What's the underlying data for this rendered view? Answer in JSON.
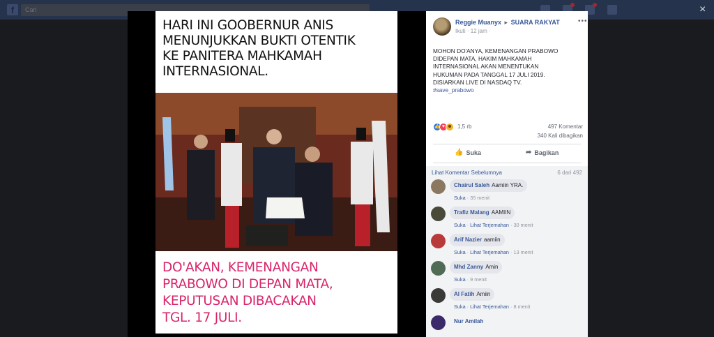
{
  "topbar": {
    "logo": "f",
    "search_placeholder": "Cari",
    "close_label": "×"
  },
  "meme": {
    "top_lines": [
      "HARI INI GOOBERNUR ANIS",
      "MENUNJUKKAN BUKTI OTENTIK",
      "KE PANITERA MAHKAMAH",
      "INTERNASIONAL."
    ],
    "bottom_lines": [
      "DO'AKAN, KEMENANGAN",
      "PRABOWO DI DEPAN MATA,",
      "KEPUTUSAN DIBACAKAN",
      "TGL. 17 JULI."
    ]
  },
  "post": {
    "author": "Reggie Muanyx",
    "arrow": "▸",
    "group": "SUARA RAKYAT",
    "meta": "Ikuti · 12 jam ·",
    "more": "•••",
    "text_lines": [
      "MOHON DO'ANYA, KEMENANGAN PRABOWO",
      "DIDEPAN MATA, HAKIM MAHKAMAH",
      "INTERNASIONAL AKAN MENENTUKAN",
      "HUKUMAN PADA TANGGAL 17 JULI 2019.",
      "DISIARKAN LIVE DI NASDAQ TV."
    ],
    "hashtag": "#save_prabowo",
    "reaction_count": "1,5 rb",
    "comments_count": "497 Komentar",
    "shares_count": "340 Kali dibagikan",
    "like_label": "Suka",
    "share_label": "Bagikan"
  },
  "comments_header": {
    "prev_link": "Lihat Komentar Sebelumnya",
    "page_count": "6 dari 492"
  },
  "comments": [
    {
      "name": "Chairul Saleh",
      "text": "Aamiin YRA.",
      "like": "Suka",
      "translate": "",
      "time": "35 menit",
      "avatar_color": "#8a7860"
    },
    {
      "name": "Trafiz Malang",
      "text": "AAMIIN",
      "like": "Suka",
      "translate": "Lihat Terjemahan",
      "time": "30 menit",
      "avatar_color": "#4a4a3a"
    },
    {
      "name": "Arif Nazier",
      "text": "aamiin",
      "like": "Suka",
      "translate": "Lihat Terjemahan",
      "time": "13 menit",
      "avatar_color": "#b83a3a"
    },
    {
      "name": "Mhd Zanny",
      "text": "Amin",
      "like": "Suka",
      "translate": "",
      "time": "9 menit",
      "avatar_color": "#4f6a55"
    },
    {
      "name": "Al Fatih",
      "text": "Amiin",
      "like": "Suka",
      "translate": "Lihat Terjemahan",
      "time": "8 menit",
      "avatar_color": "#3a3a38"
    },
    {
      "name": "Nur Amilah",
      "text": "",
      "like": "",
      "translate": "",
      "time": "",
      "avatar_color": "#3a2a6a"
    }
  ]
}
